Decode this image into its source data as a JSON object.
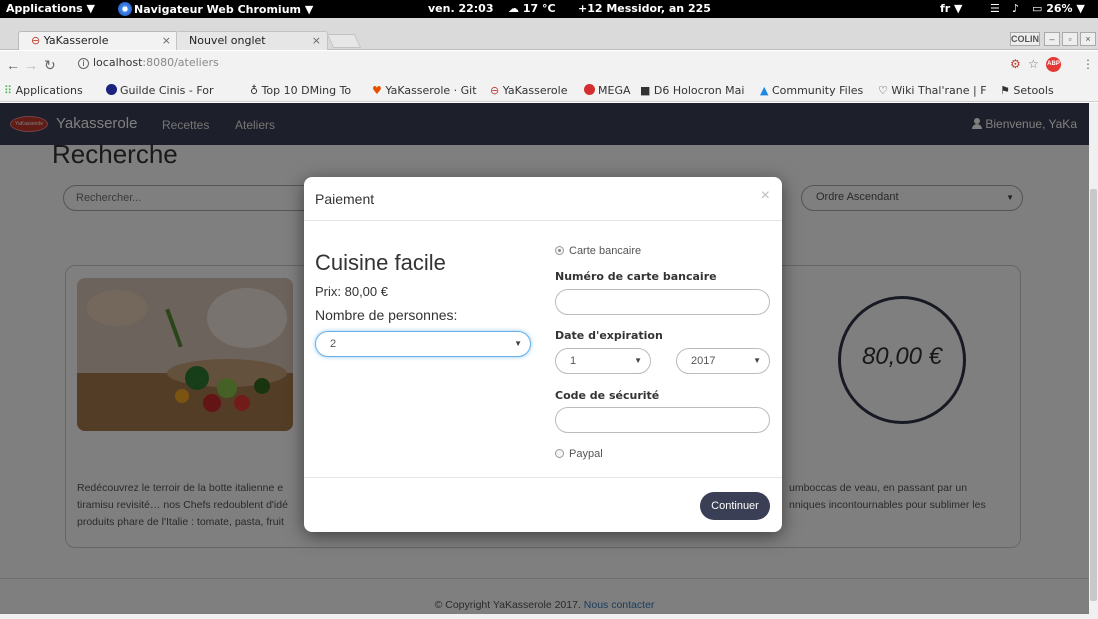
{
  "system_panel": {
    "applications": "Applications ▼",
    "active_app": "Navigateur Web Chromium ▼",
    "clock": "ven. 22:03",
    "weather": "17 °C",
    "calendar": "+12 Messidor, an 225",
    "keyboard": "fr ▼",
    "battery": "26% ▼"
  },
  "tabs": [
    {
      "label": "YaKasserole"
    },
    {
      "label": "Nouvel onglet"
    }
  ],
  "window_badge": "COLIN",
  "address_bar": {
    "host": "localhost",
    "path": ":8080/ateliers"
  },
  "bookmarks": [
    {
      "label": "Applications"
    },
    {
      "label": "Guilde Cinis - For"
    },
    {
      "label": "Top 10 DMing To"
    },
    {
      "label": "YaKasserole · Git"
    },
    {
      "label": "YaKasserole"
    },
    {
      "label": "MEGA"
    },
    {
      "label": "D6 Holocron Mai"
    },
    {
      "label": "Community Files"
    },
    {
      "label": "Wiki Thal'rane | F"
    },
    {
      "label": "Setools"
    }
  ],
  "navbar": {
    "logo_text": "YaKasserole",
    "brand": "Yakasserole",
    "links": [
      {
        "label": "Recettes"
      },
      {
        "label": "Ateliers"
      }
    ],
    "user": "Bienvenue, YaKa"
  },
  "page": {
    "title": "Recherche",
    "search_placeholder": "Rechercher...",
    "order_value": "Ordre Ascendant",
    "price_badge": "80,00 €",
    "description_start": "Redécouvrez le terroir de la botte italienne e",
    "description_lines": [
      "Redécouvrez le terroir de la botte italienne e",
      "tiramisu revisité… nos Chefs redoublent d'idé",
      "produits phare de l'Italie : tomate, pasta, fruit"
    ],
    "description_right_lines": [
      "umboccas de veau, en passant par un",
      "nniques incontournables pour sublimer les"
    ],
    "footer_text": "© Copyright YaKasserole 2017.",
    "footer_link": "Nous contacter"
  },
  "modal": {
    "title": "Paiement",
    "close": "×",
    "course_title": "Cuisine facile",
    "price": "Prix: 80,00 €",
    "persons_label": "Nombre de personnes:",
    "persons_value": "2",
    "card_option": "Carte bancaire",
    "card_number_label": "Numéro de carte bancaire",
    "card_number_value": "",
    "expiry_label": "Date d'expiration",
    "expiry_month": "1",
    "expiry_year": "2017",
    "cvv_label": "Code de sécurité",
    "cvv_value": "",
    "paypal_option": "Paypal",
    "continue_label": "Continuer"
  },
  "colors": {
    "navbar": "#3b3f55",
    "accent_link": "#337ab7",
    "focus": "#66afe9"
  }
}
